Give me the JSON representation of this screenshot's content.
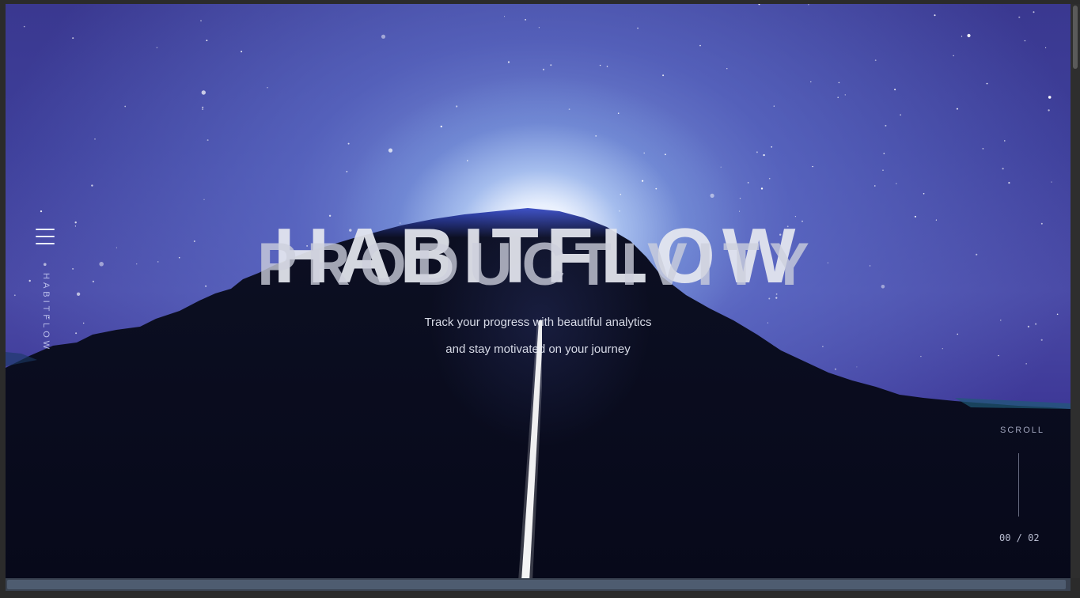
{
  "brand": {
    "title": "HABITFLOW",
    "vertical_label": "HABITFLOW"
  },
  "hero": {
    "title_overlay": "PRODUCTIVITY",
    "tagline_line1": "Track your progress with beautiful analytics",
    "tagline_line2": "and stay motivated on your journey"
  },
  "nav": {
    "menu_icon": "hamburger-menu-icon"
  },
  "scroll": {
    "label": "SCROLL",
    "counter": "00 / 02"
  },
  "colors": {
    "sky_top": "#3a3890",
    "sky_glow": "#a8c4f0",
    "mountain": "#090c1a",
    "accent_text": "#e8ecff"
  }
}
